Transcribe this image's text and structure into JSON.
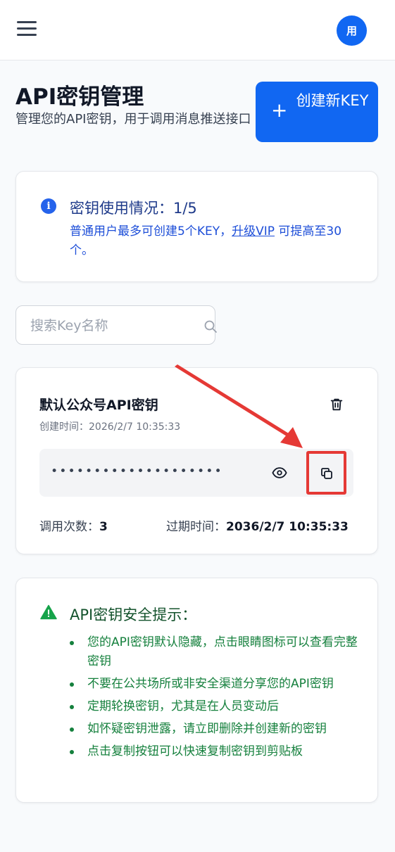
{
  "topbar": {
    "avatar_text": "用"
  },
  "header": {
    "title": "API密钥管理",
    "subtitle": "管理您的API密钥，用于调用消息推送接口",
    "create_button": {
      "icon": "+",
      "label": "创建新KEY"
    }
  },
  "usage": {
    "title": "密钥使用情况：1/5",
    "desc_before": "普通用户最多可创建5个KEY，",
    "upgrade_link": "升级VIP",
    "desc_after": " 可提高至30个。"
  },
  "search": {
    "placeholder": "搜索Key名称",
    "value": ""
  },
  "key_card": {
    "name": "默认公众号API密钥",
    "created": "创建时间：2026/2/7 10:35:33",
    "masked_key": "••••••••••••••••••••",
    "calls_label": "调用次数：",
    "calls_value": "3",
    "expire_label": "过期时间：",
    "expire_value": "2036/2/7 10:35:33"
  },
  "security": {
    "title": "API密钥安全提示：",
    "tips": [
      "您的API密钥默认隐藏，点击眼睛图标可以查看完整密钥",
      "不要在公共场所或非安全渠道分享您的API密钥",
      "定期轮换密钥，尤其是在人员变动后",
      "如怀疑密钥泄露，请立即删除并创建新的密钥",
      "点击复制按钮可以快速复制密钥到剪贴板"
    ]
  },
  "colors": {
    "primary": "#1167f2",
    "annotation": "#e53935",
    "success": "#15803d"
  }
}
